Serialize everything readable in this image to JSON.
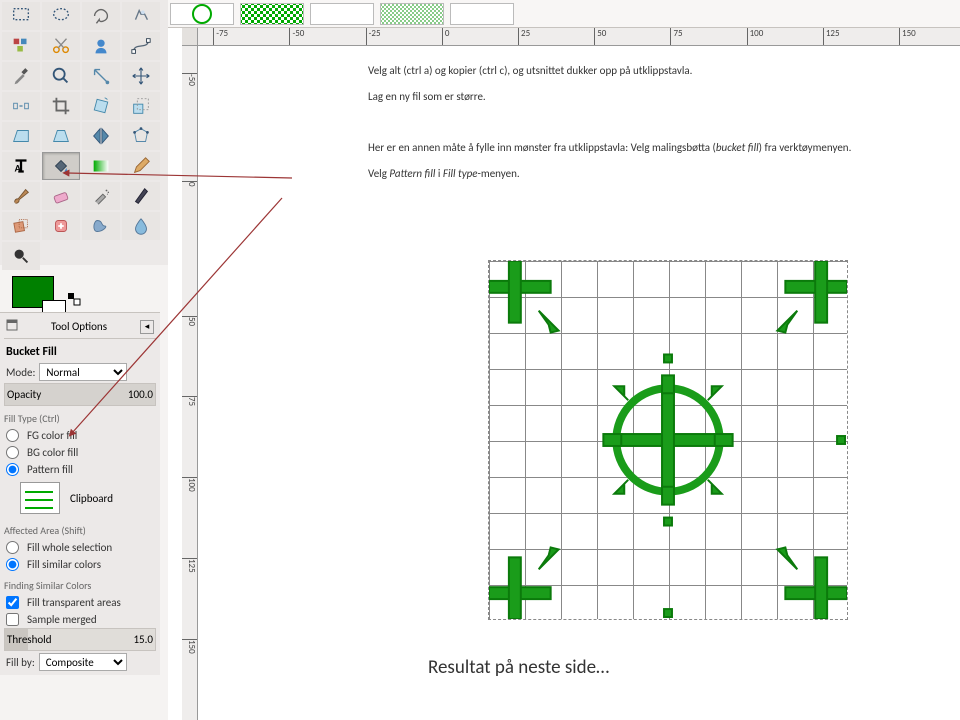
{
  "toolOptions": {
    "header": "Tool Options",
    "title": "Bucket Fill",
    "modeLabel": "Mode:",
    "modeValue": "Normal",
    "opacityLabel": "Opacity",
    "opacityValue": "100.0"
  },
  "fillType": {
    "section": "Fill Type  (Ctrl)",
    "fg": "FG color fill",
    "bg": "BG color fill",
    "pattern": "Pattern fill",
    "patternSource": "Clipboard"
  },
  "affectedArea": {
    "section": "Affected Area  (Shift)",
    "whole": "Fill whole selection",
    "similar": "Fill similar colors"
  },
  "findingColors": {
    "section": "Finding Similar Colors",
    "transparent": "Fill transparent areas",
    "sampleMerged": "Sample merged",
    "thresholdLabel": "Threshold",
    "thresholdValue": "15.0",
    "fillByLabel": "Fill by:",
    "fillByValue": "Composite"
  },
  "ruler": {
    "h": [
      "-75",
      "-50",
      "-25",
      "0",
      "25",
      "50",
      "75",
      "100",
      "125",
      "150"
    ],
    "v": [
      "-50",
      "0",
      "50",
      "75",
      "100",
      "125",
      "150"
    ]
  },
  "instruction": {
    "p1a": "Velg alt (ctrl a) og kopier (ctrl c), og utsnittet dukker opp på utklippstavla.",
    "p1b": "Lag en ny fil som er større.",
    "p2a": "Her er en annen måte å fylle inn mønster fra utklippstavla: Velg malingsbøtta (",
    "p2em1": "bucket fill",
    "p2b": ") fra verktøymenyen.",
    "p3a": "Velg ",
    "p3em2": "Pattern fill",
    "p3b": " i ",
    "p3em3": "Fill type",
    "p3c": "-menyen."
  },
  "resultText": "Resultat på neste side…",
  "tools": [
    "rect-select",
    "ellipse-select",
    "freehand",
    "fuzzy",
    "color-select",
    "scissors",
    "foreground",
    "paths",
    "eyedropper",
    "zoom",
    "measure",
    "move",
    "align",
    "crop",
    "rotate",
    "scale",
    "shear",
    "perspective",
    "flip",
    "cage",
    "text",
    "bucket",
    "gradient",
    "heal",
    "pencil",
    "eraser",
    "airbrush",
    "clone",
    "smudge",
    "blur",
    "dodge",
    "ink"
  ]
}
